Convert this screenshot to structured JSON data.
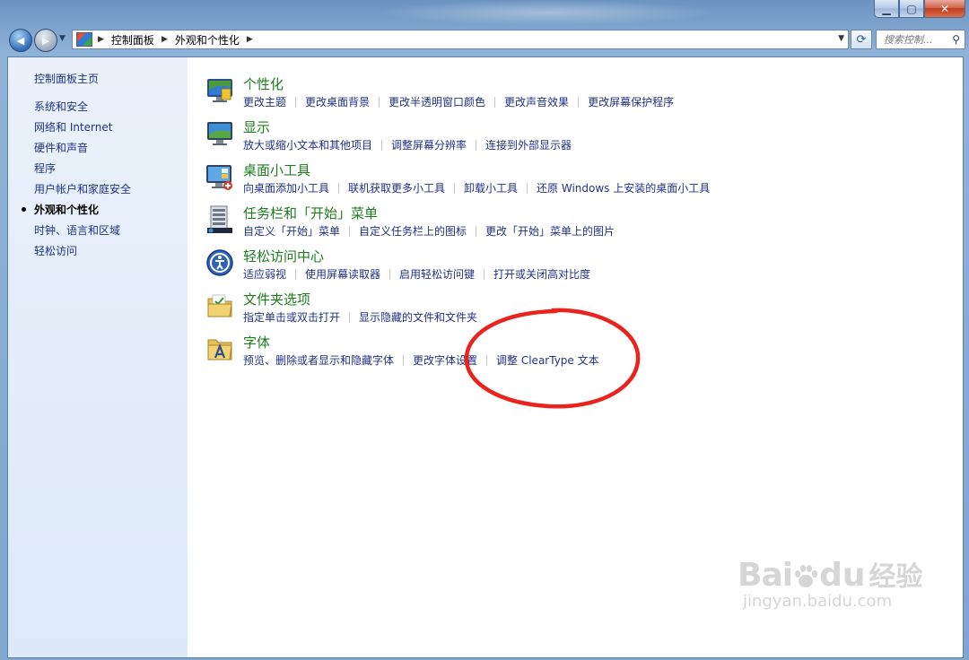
{
  "window": {
    "caption": {
      "minimize": "▁",
      "maximize": "▢",
      "close": "✕"
    }
  },
  "nav": {
    "back_glyph": "◀",
    "forward_glyph": "▶",
    "breadcrumbs": [
      "控制面板",
      "外观和个性化"
    ],
    "search_placeholder": "搜索控制...",
    "refresh_glyph": "⟳"
  },
  "sidebar": {
    "home": "控制面板主页",
    "items": [
      {
        "label": "系统和安全",
        "active": false
      },
      {
        "label": "网络和 Internet",
        "active": false
      },
      {
        "label": "硬件和声音",
        "active": false
      },
      {
        "label": "程序",
        "active": false
      },
      {
        "label": "用户帐户和家庭安全",
        "active": false
      },
      {
        "label": "外观和个性化",
        "active": true
      },
      {
        "label": "时钟、语言和区域",
        "active": false
      },
      {
        "label": "轻松访问",
        "active": false
      }
    ]
  },
  "categories": [
    {
      "icon": "personalization-icon",
      "title": "个性化",
      "links": [
        "更改主题",
        "更改桌面背景",
        "更改半透明窗口颜色",
        "更改声音效果",
        "更改屏幕保护程序"
      ]
    },
    {
      "icon": "display-icon",
      "title": "显示",
      "links": [
        "放大或缩小文本和其他项目",
        "调整屏幕分辨率",
        "连接到外部显示器"
      ]
    },
    {
      "icon": "gadgets-icon",
      "title": "桌面小工具",
      "links": [
        "向桌面添加小工具",
        "联机获取更多小工具",
        "卸载小工具",
        "还原 Windows 上安装的桌面小工具"
      ]
    },
    {
      "icon": "taskbar-icon",
      "title": "任务栏和「开始」菜单",
      "links": [
        "自定义「开始」菜单",
        "自定义任务栏上的图标",
        "更改「开始」菜单上的图片"
      ]
    },
    {
      "icon": "ease-of-access-icon",
      "title": "轻松访问中心",
      "links": [
        "适应弱视",
        "使用屏幕读取器",
        "启用轻松访问键",
        "打开或关闭高对比度"
      ]
    },
    {
      "icon": "folder-options-icon",
      "title": "文件夹选项",
      "links": [
        "指定单击或双击打开",
        "显示隐藏的文件和文件夹"
      ]
    },
    {
      "icon": "fonts-icon",
      "title": "字体",
      "links": [
        "预览、删除或者显示和隐藏字体",
        "更改字体设置",
        "调整 ClearType 文本"
      ]
    }
  ],
  "watermark": {
    "brand": "Bai",
    "brand2": "du",
    "cn": "经验",
    "url": "jingyan.baidu.com"
  },
  "colors": {
    "link": "#1e3287",
    "title_green": "#1e7b1e",
    "annotation_red": "#e8241c"
  }
}
